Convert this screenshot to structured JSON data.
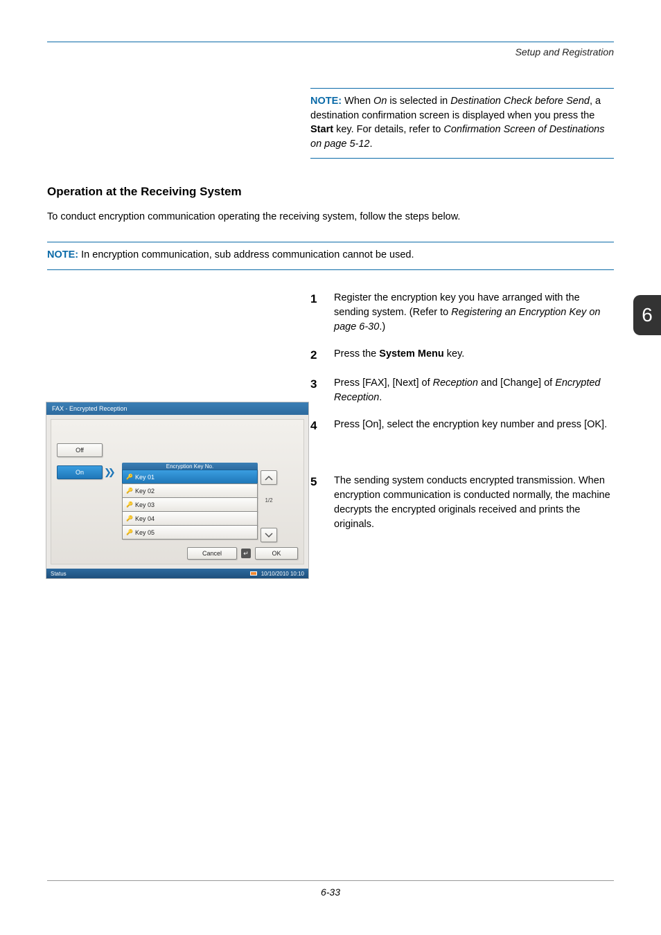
{
  "header": {
    "section": "Setup and Registration"
  },
  "tab": {
    "chapter": "6"
  },
  "footer": {
    "page": "6-33"
  },
  "note1": {
    "label": "NOTE:",
    "text_before": " When ",
    "italic1": "On",
    "text_mid1": " is selected in ",
    "italic2": "Destination Check before Send",
    "text_mid2": ", a destination confirmation screen is displayed when you press the ",
    "bold1": "Start",
    "text_mid3": " key. For details, refer to ",
    "italic3": "Confirmation Screen of Destinations on page 5-12",
    "text_end": "."
  },
  "heading2": "Operation at the Receiving System",
  "intro": "To conduct encryption communication operating the receiving system, follow the steps below.",
  "note2": {
    "label": "NOTE:",
    "text": " In encryption communication, sub address communication cannot be used."
  },
  "steps": {
    "s1": {
      "num": "1",
      "t1": "Register the encryption key you have arranged with the sending system. (Refer to ",
      "i1": "Registering an Encryption Key on page 6-30",
      "t2": ".)"
    },
    "s2": {
      "num": "2",
      "t1": "Press the ",
      "b1": "System Menu",
      "t2": " key."
    },
    "s3": {
      "num": "3",
      "t1": "Press [FAX], [Next] of ",
      "i1": "Reception",
      "t2": " and [Change] of ",
      "i2": "Encrypted Reception",
      "t3": "."
    },
    "s4": {
      "num": "4",
      "t1": "Press [On], select the encryption key number and press [OK]."
    },
    "s5": {
      "num": "5",
      "t1": "The sending system conducts encrypted transmission. When encryption communication is conducted normally, the machine decrypts the encrypted originals received and prints the originals."
    }
  },
  "dialog": {
    "title": "FAX - Encrypted Reception",
    "off": "Off",
    "on": "On",
    "enc_header": "Encryption Key No.",
    "keys": [
      "Key 01",
      "Key 02",
      "Key 03",
      "Key 04",
      "Key 05"
    ],
    "page": "1/2",
    "cancel": "Cancel",
    "ok": "OK",
    "status": "Status",
    "datetime": "10/10/2010  10:10"
  }
}
